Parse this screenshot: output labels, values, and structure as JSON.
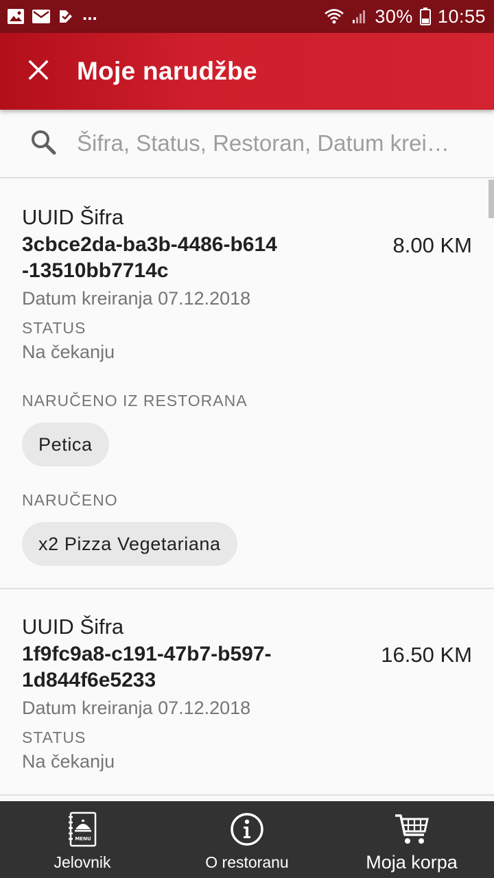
{
  "status_bar": {
    "battery": "30%",
    "time": "10:55",
    "dots": "..."
  },
  "app_bar": {
    "title": "Moje narudžbe",
    "close_icon": "close-icon"
  },
  "search": {
    "placeholder": "Šifra, Status, Restoran, Datum krei…",
    "value": ""
  },
  "orders": [
    {
      "uuid_label": "UUID Šifra",
      "uuid": "3cbce2da-ba3b-4486-b614-13510bb7714c",
      "price": "8.00 KM",
      "date": "Datum kreiranja 07.12.2018",
      "status_label": "STATUS",
      "status": "Na čekanju",
      "restaurant_label": "NARUČENO IZ RESTORANA",
      "restaurant": "Petica",
      "ordered_label": "NARUČENO",
      "ordered_items": [
        "x2 Pizza Vegetariana"
      ]
    },
    {
      "uuid_label": "UUID Šifra",
      "uuid": "1f9fc9a8-c191-47b7-b597-1d844f6e5233",
      "price": "16.50 KM",
      "date": "Datum kreiranja 07.12.2018",
      "status_label": "STATUS",
      "status": "Na čekanju"
    }
  ],
  "bottom_nav": {
    "items": [
      {
        "label": "Jelovnik",
        "icon": "menu-book-icon"
      },
      {
        "label": "O restoranu",
        "icon": "info-icon"
      },
      {
        "label": "Moja korpa",
        "icon": "shopping-cart-icon"
      }
    ],
    "active_index": 2
  },
  "colors": {
    "status_bar": "#7d0f17",
    "app_bar": "#d32230",
    "bottom_nav": "#323232",
    "chip": "#e8e8e8"
  }
}
